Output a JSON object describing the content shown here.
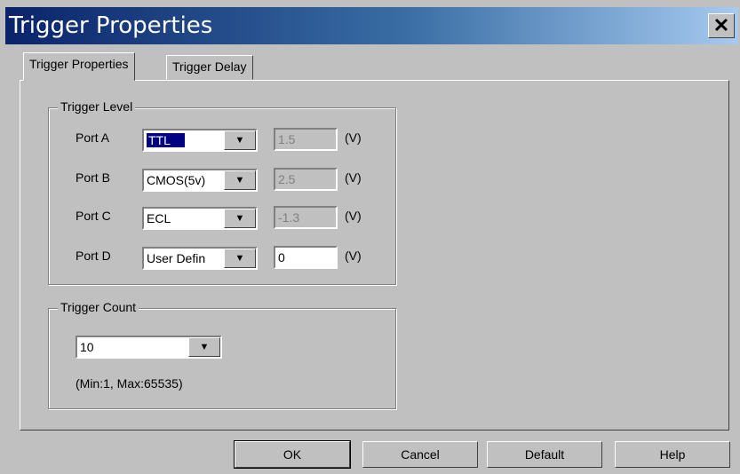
{
  "window": {
    "title": "Trigger Properties",
    "close_label": "✕"
  },
  "tabs": [
    {
      "label": "Trigger Properties"
    },
    {
      "label": "Trigger Delay"
    }
  ],
  "trigger_level": {
    "title": "Trigger Level",
    "unit": "(V)",
    "ports": [
      {
        "label": "Port A",
        "selected": "TTL",
        "voltage": "1.5"
      },
      {
        "label": "Port B",
        "selected": "CMOS(5v)",
        "voltage": "2.5"
      },
      {
        "label": "Port C",
        "selected": "ECL",
        "voltage": "-1.3"
      },
      {
        "label": "Port D",
        "selected": "User Defin",
        "voltage": "0"
      }
    ]
  },
  "trigger_count": {
    "title": "Trigger Count",
    "selected": "10",
    "hint": "(Min:1, Max:65535)"
  },
  "buttons": {
    "ok": "OK",
    "cancel": "Cancel",
    "default": "Default",
    "help": "Help"
  }
}
